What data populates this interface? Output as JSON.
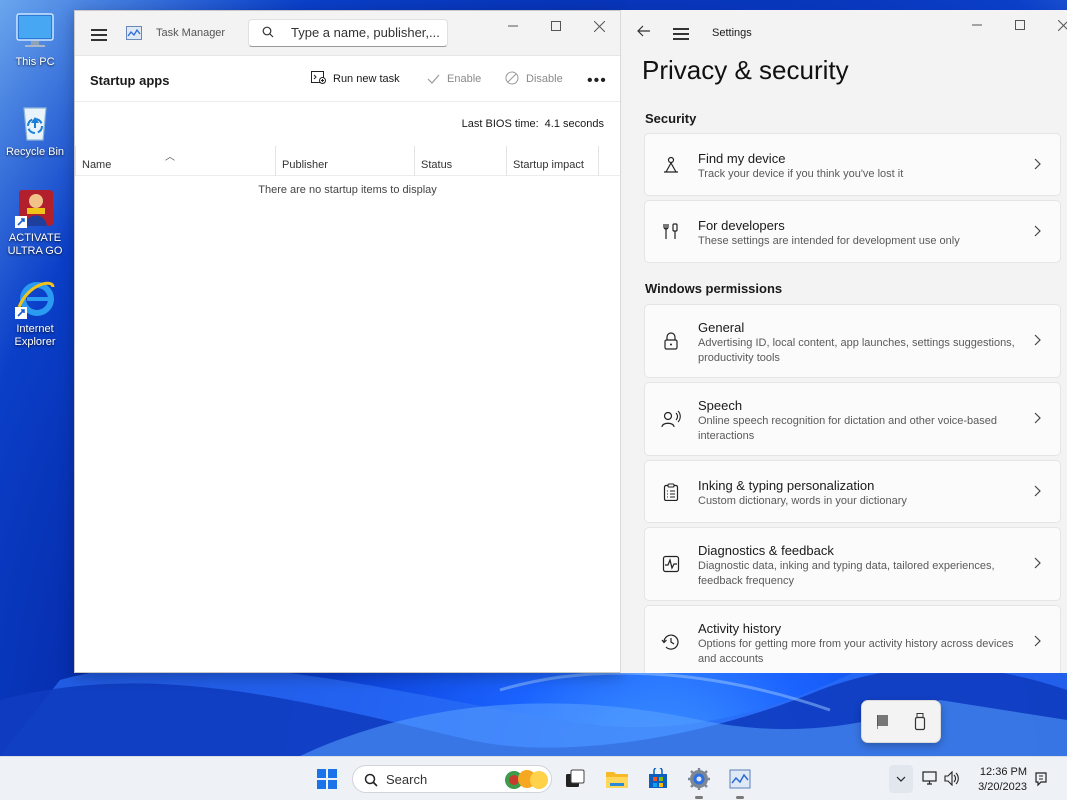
{
  "desktop": {
    "icons": [
      {
        "label": "This PC",
        "icon": "monitor-icon"
      },
      {
        "label": "Recycle Bin",
        "icon": "recycle-bin-icon"
      },
      {
        "label": "ACTIVATE ULTRA GO",
        "icon": "app-shortcut-icon"
      },
      {
        "label": "Internet Explorer",
        "icon": "internet-explorer-icon"
      }
    ]
  },
  "task_manager": {
    "title": "Task Manager",
    "search_placeholder": "Type a name, publisher,...",
    "page_title": "Startup apps",
    "toolbar": {
      "run_new_task": "Run new task",
      "enable": "Enable",
      "disable": "Disable"
    },
    "bios_label": "Last BIOS time:",
    "bios_value": "4.1 seconds",
    "columns": [
      "Name",
      "Publisher",
      "Status",
      "Startup impact"
    ],
    "empty_message": "There are no startup items to display"
  },
  "settings": {
    "app_title": "Settings",
    "page_title": "Privacy & security",
    "sections": {
      "security": "Security",
      "windows_permissions": "Windows permissions"
    },
    "security_items": [
      {
        "title": "Find my device",
        "subtitle": "Track your device if you think you've lost it",
        "icon": "person-location-icon"
      },
      {
        "title": "For developers",
        "subtitle": "These settings are intended for development use only",
        "icon": "developer-tools-icon"
      }
    ],
    "permission_items": [
      {
        "title": "General",
        "subtitle": "Advertising ID, local content, app launches, settings suggestions, productivity tools",
        "icon": "lock-icon"
      },
      {
        "title": "Speech",
        "subtitle": "Online speech recognition for dictation and other voice-based interactions",
        "icon": "speech-icon"
      },
      {
        "title": "Inking & typing personalization",
        "subtitle": "Custom dictionary, words in your dictionary",
        "icon": "clipboard-list-icon"
      },
      {
        "title": "Diagnostics & feedback",
        "subtitle": "Diagnostic data, inking and typing data, tailored experiences, feedback frequency",
        "icon": "diagnostics-icon"
      },
      {
        "title": "Activity history",
        "subtitle": "Options for getting more from your activity history across devices and accounts",
        "icon": "history-icon"
      }
    ]
  },
  "taskbar": {
    "search_label": "Search",
    "time": "12:36 PM",
    "date": "3/20/2023",
    "apps": [
      "start-icon",
      "search-icon",
      "task-view-icon",
      "file-explorer-icon",
      "store-icon",
      "settings-icon",
      "task-manager-icon"
    ]
  }
}
